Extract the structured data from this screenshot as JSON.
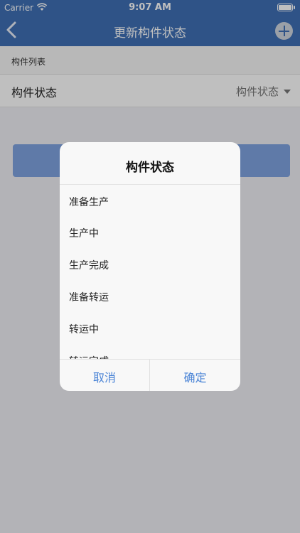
{
  "status_bar": {
    "carrier": "Carrier",
    "time": "9:07 AM"
  },
  "nav": {
    "title": "更新构件状态",
    "back_icon": "chevron-left-icon",
    "add_icon": "plus-circle-icon",
    "bar_color": "#3f6fb4"
  },
  "section": {
    "header": "构件列表"
  },
  "status_row": {
    "label": "构件状态",
    "value": "构件状态"
  },
  "dialog": {
    "title": "构件状态",
    "options": [
      "准备生产",
      "生产中",
      "生产完成",
      "准备转运",
      "转运中",
      "转运完成"
    ],
    "cancel_label": "取消",
    "confirm_label": "确定",
    "accent_color": "#4a84d6"
  }
}
